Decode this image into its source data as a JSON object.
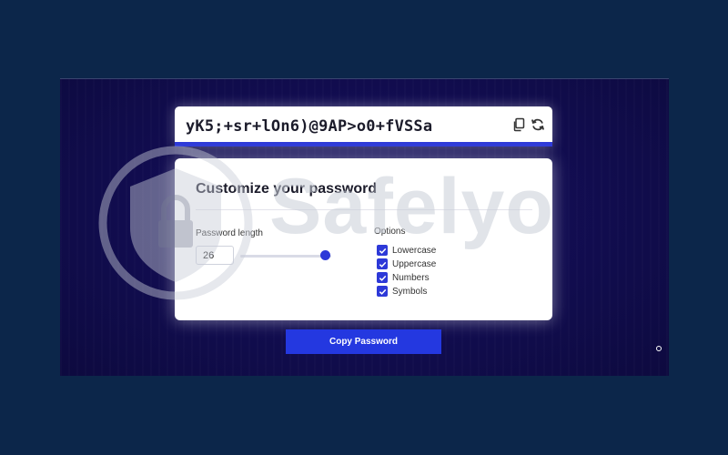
{
  "password": {
    "value": "yK5;+sr+lOn6)@9AP>o0+fVSSa",
    "icons": [
      "copy-icon",
      "refresh-icon"
    ]
  },
  "settings": {
    "title": "Customize your password",
    "length_label": "Password length",
    "length_value": "26",
    "slider_fraction": 0.88,
    "options_label": "Options",
    "options": [
      {
        "label": "Lowercase",
        "checked": true
      },
      {
        "label": "Uppercase",
        "checked": true
      },
      {
        "label": "Numbers",
        "checked": true
      },
      {
        "label": "Symbols",
        "checked": true
      }
    ]
  },
  "actions": {
    "copy_label": "Copy Password"
  },
  "watermark": {
    "text": "Safelyo"
  },
  "colors": {
    "page_bg": "#0c264a",
    "screen_bg": "#120d52",
    "accent": "#2d39d8",
    "button": "#2438e0"
  }
}
